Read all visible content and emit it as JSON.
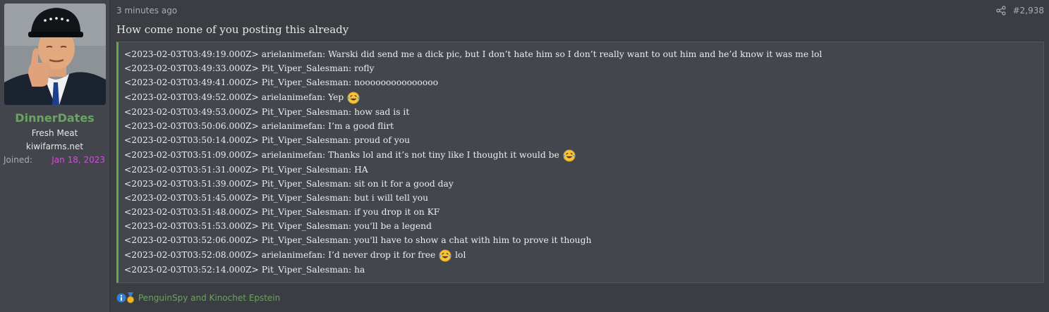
{
  "user": {
    "name": "DinnerDates",
    "title": "Fresh Meat",
    "banner": "kiwifarms.net",
    "joined_label": "Joined:",
    "joined_date": "Jan 18, 2023"
  },
  "post": {
    "time": "3 minutes ago",
    "number": "#2,938",
    "lead": "How come none of you posting this already",
    "quote_lines": [
      {
        "text": "<2023-02-03T03:49:19.000Z> arielanimefan: Warski did send me a dick pic, but I don’t hate him so I don’t really want to out him and he’d know it was me lol"
      },
      {
        "text": "<2023-02-03T03:49:33.000Z> Pit_Viper_Salesman: rofly"
      },
      {
        "text": "<2023-02-03T03:49:41.000Z> Pit_Viper_Salesman: nooooooooooooooo"
      },
      {
        "text": "<2023-02-03T03:49:52.000Z> arielanimefan: Yep",
        "emoji": "rofl-emoji"
      },
      {
        "text": "<2023-02-03T03:49:53.000Z> Pit_Viper_Salesman: how sad is it"
      },
      {
        "text": "<2023-02-03T03:50:06.000Z> arielanimefan: I’m a good flirt"
      },
      {
        "text": "<2023-02-03T03:50:14.000Z> Pit_Viper_Salesman: proud of you"
      },
      {
        "text": "<2023-02-03T03:51:09.000Z> arielanimefan: Thanks lol and it’s not tiny like I thought it would be",
        "emoji": "rofl-emoji"
      },
      {
        "text": "<2023-02-03T03:51:31.000Z> Pit_Viper_Salesman: HA"
      },
      {
        "text": "<2023-02-03T03:51:39.000Z> Pit_Viper_Salesman: sit on it for a good day"
      },
      {
        "text": "<2023-02-03T03:51:45.000Z> Pit_Viper_Salesman: but i will tell you"
      },
      {
        "text": "<2023-02-03T03:51:48.000Z> Pit_Viper_Salesman: if you drop it on KF"
      },
      {
        "text": "<2023-02-03T03:51:53.000Z> Pit_Viper_Salesman: you'll be a legend"
      },
      {
        "text": "<2023-02-03T03:52:06.000Z> Pit_Viper_Salesman: you'll have to show a chat with him to prove it though"
      },
      {
        "text": "<2023-02-03T03:52:08.000Z> arielanimefan: I’d never drop it for free",
        "emoji": "rofl-emoji",
        "after": " lol"
      },
      {
        "text": "<2023-02-03T03:52:14.000Z> Pit_Viper_Salesman: ha"
      }
    ]
  },
  "reactions": {
    "text": "PenguinSpy and Kinochet Epstein",
    "icons": [
      "informative-icon",
      "medal-icon"
    ]
  },
  "colors": {
    "background": "#3a3d42",
    "sidebar": "#42464c",
    "username": "#6ba361",
    "quote_border": "#63a74f",
    "joined_date": "#d24ddb"
  }
}
